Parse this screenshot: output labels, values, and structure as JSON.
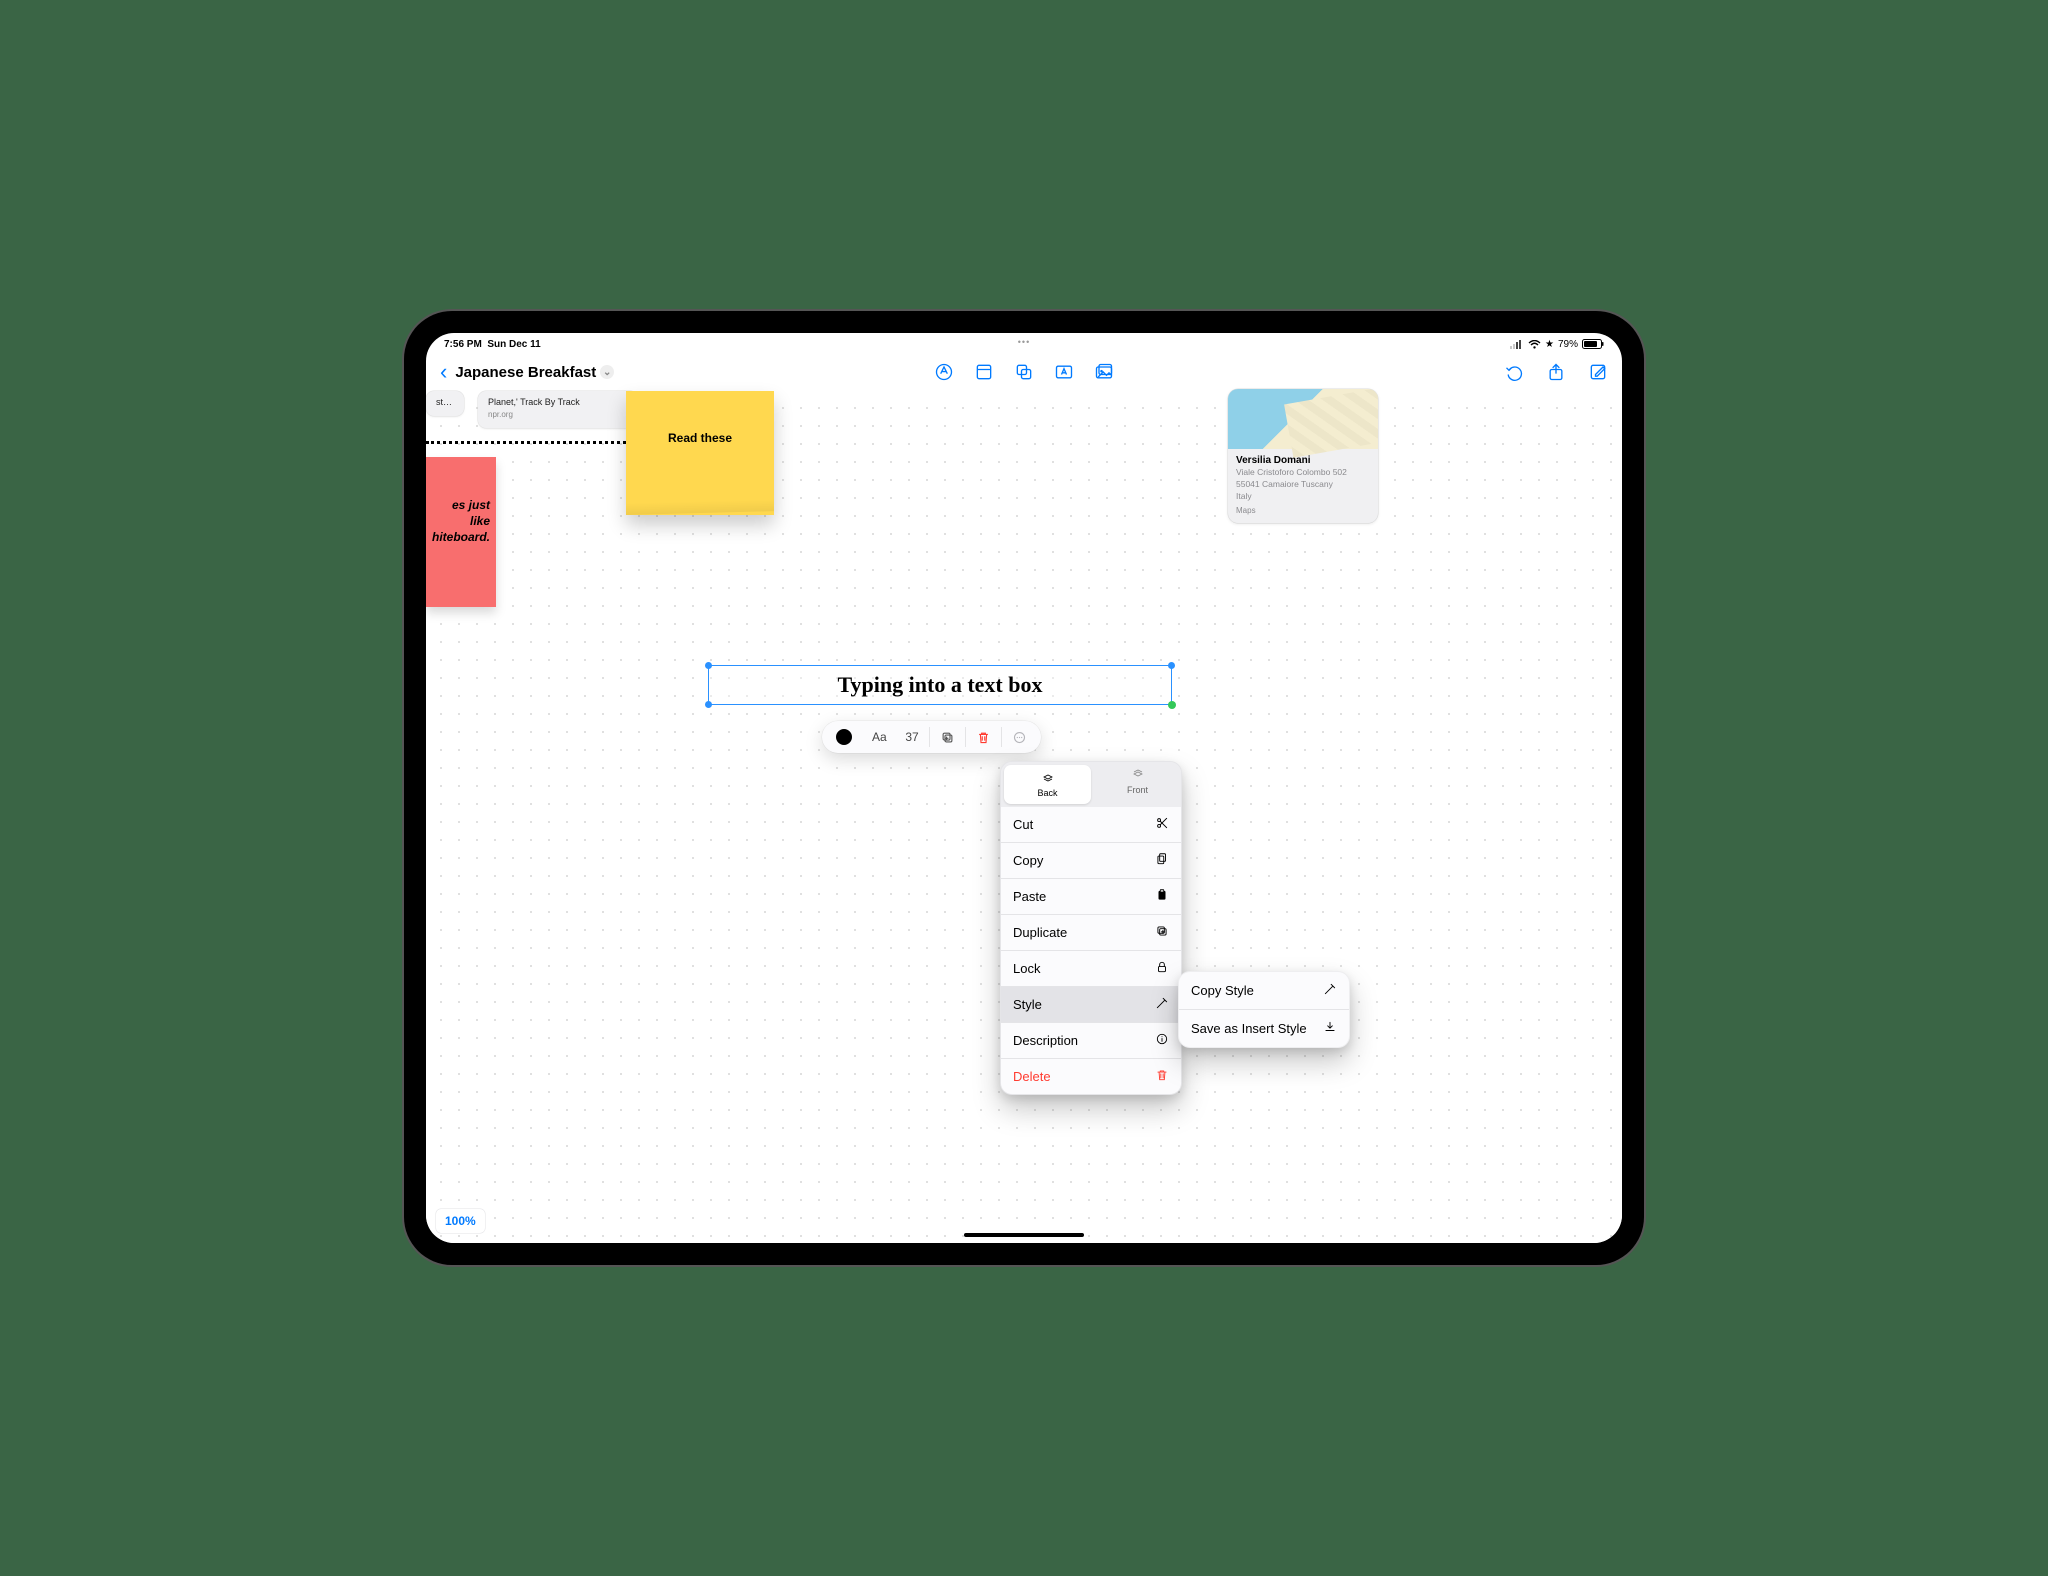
{
  "colors": {
    "accent": "#007aff",
    "danger": "#ff3b30"
  },
  "status": {
    "time": "7:56 PM",
    "date": "Sun Dec 11",
    "battery_pct": "79%"
  },
  "toolbar": {
    "title": "Japanese Breakfast",
    "center_tools": [
      "pen-tool",
      "note-tool",
      "shapes-tool",
      "text-tool",
      "media-tool"
    ],
    "right_tools": [
      "undo",
      "share",
      "compose"
    ]
  },
  "canvas": {
    "link_stub_title": "st…",
    "link_card": {
      "title": "Planet,' Track By Track",
      "source": "npr.org"
    },
    "yellow_note_text": "Read these",
    "red_note_line1": "es just like",
    "red_note_line2": "hiteboard.",
    "map": {
      "name": "Versilia Domani",
      "addr_line1": "Viale Cristoforo Colombo 502",
      "addr_line2": "55041 Camaiore Tuscany",
      "addr_line3": "Italy",
      "source": " Maps"
    },
    "textbox_value": "Typing into a text box",
    "zoom_label": "100%"
  },
  "edit_pill": {
    "font_label": "Aa",
    "font_size": "37"
  },
  "context_menu": {
    "back_label": "Back",
    "front_label": "Front",
    "back_selected": true,
    "items": [
      {
        "key": "cut",
        "label": "Cut",
        "icon": "scissors"
      },
      {
        "key": "copy",
        "label": "Copy",
        "icon": "two-docs"
      },
      {
        "key": "paste",
        "label": "Paste",
        "icon": "clipboard"
      },
      {
        "key": "duplicate",
        "label": "Duplicate",
        "icon": "dup"
      },
      {
        "key": "lock",
        "label": "Lock",
        "icon": "lock"
      },
      {
        "key": "style",
        "label": "Style",
        "icon": "dropper",
        "active": true
      },
      {
        "key": "description",
        "label": "Description",
        "icon": "info"
      },
      {
        "key": "delete",
        "label": "Delete",
        "icon": "trash",
        "danger": true
      }
    ]
  },
  "submenu": {
    "items": [
      {
        "key": "copy-style",
        "label": "Copy Style",
        "icon": "dropper"
      },
      {
        "key": "save-insert-style",
        "label": "Save as Insert Style",
        "icon": "save"
      }
    ]
  }
}
